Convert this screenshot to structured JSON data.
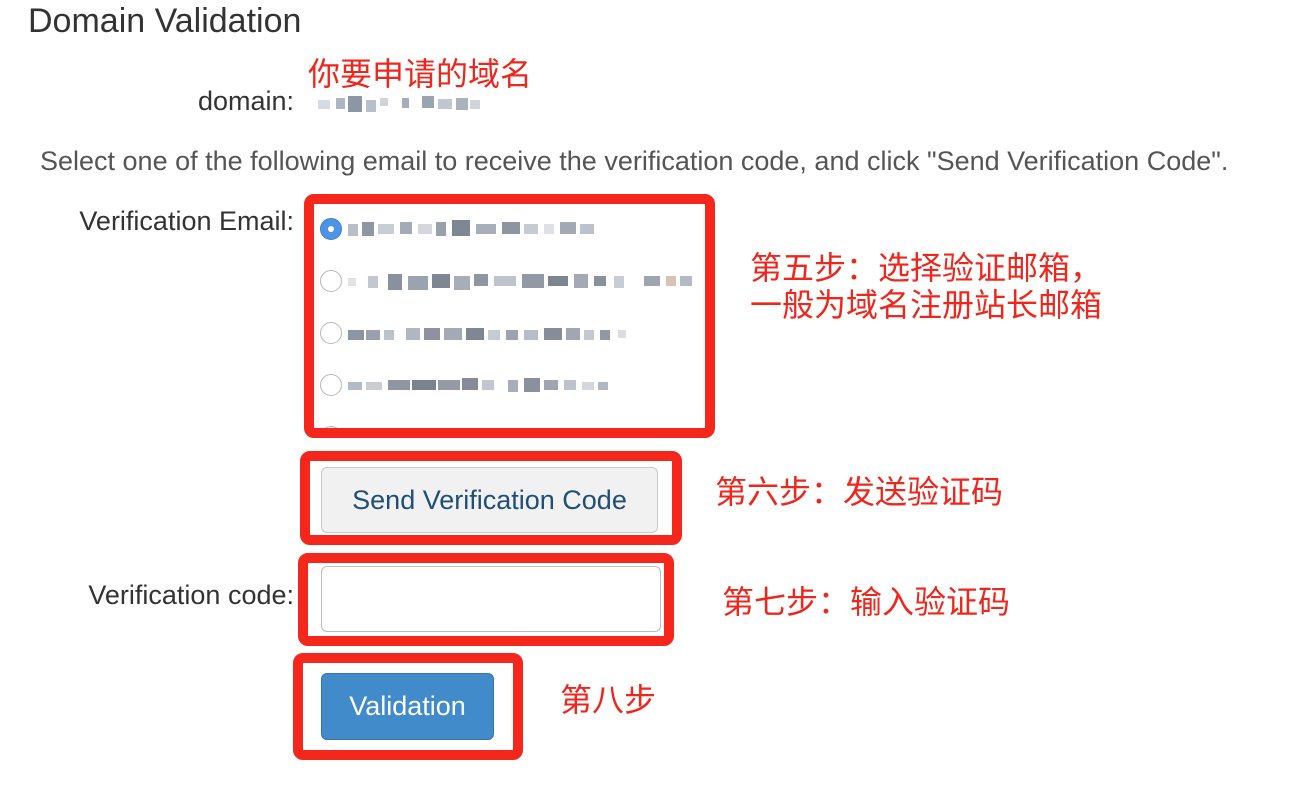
{
  "page": {
    "title": "Domain Validation"
  },
  "domain": {
    "label": "domain:"
  },
  "instruction": "Select one of the following email to receive the verification code, and click \"Send Verification Code\".",
  "verification_email": {
    "label": "Verification Email:",
    "options": [
      {
        "checked": true
      },
      {
        "checked": false
      },
      {
        "checked": false
      },
      {
        "checked": false
      },
      {
        "checked": false
      }
    ]
  },
  "send_button": {
    "label": "Send Verification Code"
  },
  "verification_code": {
    "label": "Verification code:",
    "value": ""
  },
  "validate_button": {
    "label": "Validation"
  },
  "annotations": {
    "domain_note": "你要申请的域名",
    "step5_line1": "第五步：选择验证邮箱，",
    "step5_line2": "一般为域名注册站长邮箱",
    "step6": "第六步：发送验证码",
    "step7": "第七步：输入验证码",
    "step8": "第八步"
  },
  "colors": {
    "annotation_red": "#f5261c",
    "primary_button": "#428bca",
    "radio_checked": "#4f93e6"
  }
}
